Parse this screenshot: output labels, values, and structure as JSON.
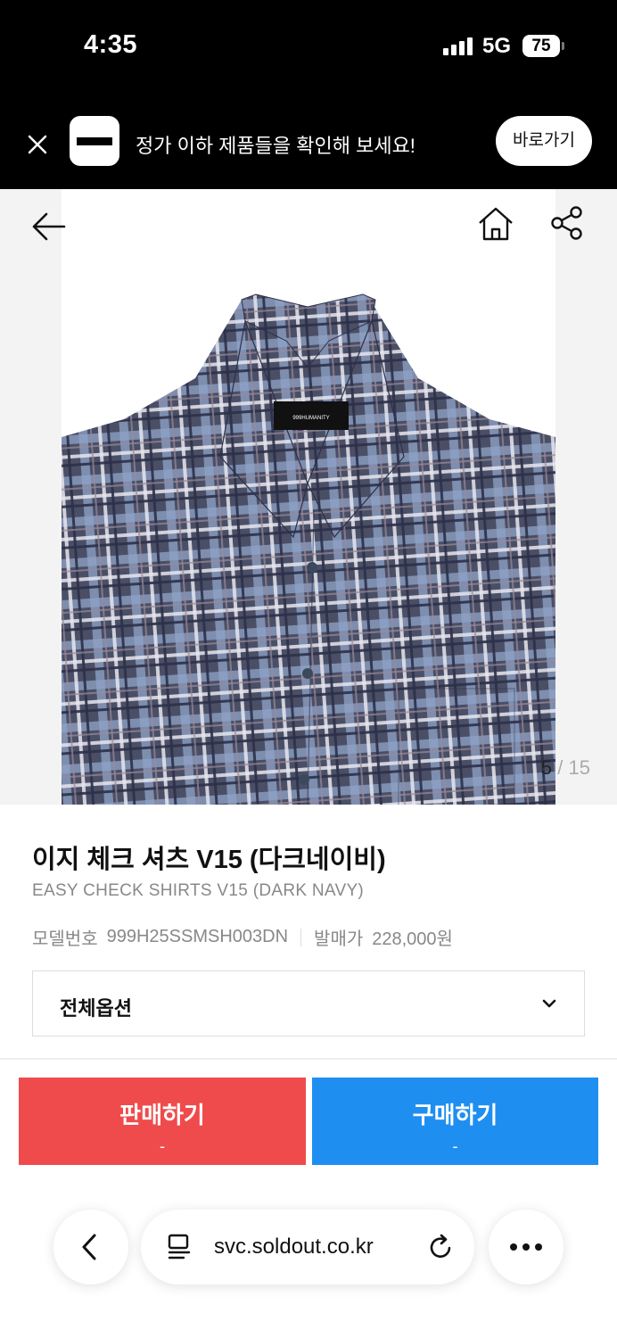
{
  "status_bar": {
    "time": "4:35",
    "network": "5G",
    "battery": "75"
  },
  "banner": {
    "text": "정가 이하 제품들을 확인해 보세요!",
    "button_label": "바로가기"
  },
  "gallery": {
    "current": "5",
    "total": "/ 15",
    "shirt_label": "999HUMANITY"
  },
  "product": {
    "title": "이지 체크 셔츠 V15 (다크네이비)",
    "subtitle": "EASY CHECK SHIRTS V15 (DARK NAVY)",
    "model_label": "모델번호",
    "model_value": "999H25SSMSH003DN",
    "price_label": "발매가",
    "price_value": "228,000원",
    "options_label": "전체옵션"
  },
  "actions": {
    "sell_label": "판매하기",
    "sell_price": "-",
    "buy_label": "구매하기",
    "buy_price": "-"
  },
  "browser": {
    "url": "svc.soldout.co.kr"
  },
  "colors": {
    "sell": "#ef4b4c",
    "buy": "#1f8ef1",
    "banner_bg": "#000000"
  }
}
